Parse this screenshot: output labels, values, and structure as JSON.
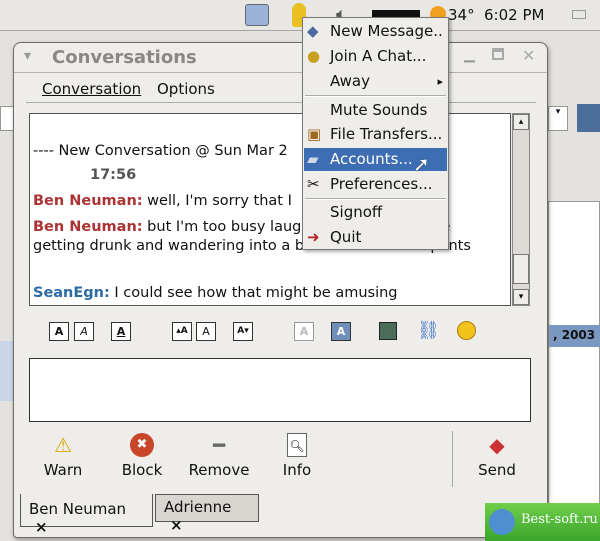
{
  "panel": {
    "weather": "34°",
    "clock": "6:02 PM"
  },
  "window": {
    "title": "Conversations",
    "menu": [
      "Conversation",
      "Options"
    ]
  },
  "chat": {
    "header": "---- New Conversation @ Sun Mar  2",
    "time": "17:56",
    "messages": [
      {
        "nick": "Ben Neuman:",
        "text": " well, I'm sorry that I"
      },
      {
        "nick": "Ben Neuman:",
        "text": " but I'm too busy laughing about someone getting drunk and wandering into a beach bar with no pants"
      },
      {
        "nick": "SeanEgn:",
        "text": " I could see how that might be amusing"
      }
    ]
  },
  "actions": [
    {
      "label": "Warn",
      "icon": "warning-icon"
    },
    {
      "label": "Block",
      "icon": "block-icon"
    },
    {
      "label": "Remove",
      "icon": "remove-icon"
    },
    {
      "label": "Info",
      "icon": "info-icon"
    },
    {
      "label": "Send",
      "icon": "send-icon"
    }
  ],
  "tabs": [
    {
      "label": "Ben Neuman",
      "close": "×"
    },
    {
      "label": "Adrienne",
      "close": "×"
    }
  ],
  "popup": {
    "items": [
      {
        "label": "New Message..",
        "icon": "new-message-icon"
      },
      {
        "label": "Join A Chat...",
        "icon": "join-chat-icon"
      },
      {
        "label": "Away",
        "submenu": "▸"
      },
      {
        "label": "Mute Sounds"
      },
      {
        "label": "File Transfers...",
        "icon": "file-transfer-icon"
      },
      {
        "label": "Accounts...",
        "icon": "accounts-icon",
        "highlighted": true
      },
      {
        "label": "Preferences...",
        "icon": "preferences-icon"
      },
      {
        "label": "Signoff"
      },
      {
        "label": "Quit",
        "icon": "quit-icon"
      }
    ]
  },
  "background": {
    "date_fragment": ", 2003"
  },
  "watermark": "Best-soft.ru",
  "colors": {
    "highlight": "#3d6db3",
    "nick_self": "#a33333",
    "nick_other": "#2b6aa3"
  }
}
